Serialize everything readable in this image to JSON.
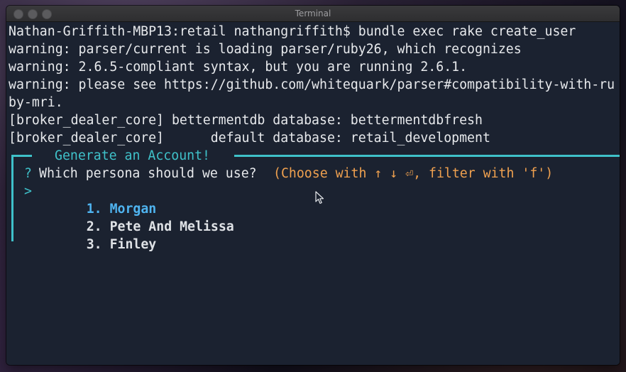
{
  "window": {
    "title": "Terminal"
  },
  "terminal": {
    "lines": [
      "Nathan-Griffith-MBP13:retail nathangriffith$ bundle exec rake create_user",
      "warning: parser/current is loading parser/ruby26, which recognizes",
      "warning: 2.6.5-compliant syntax, but you are running 2.6.1.",
      "warning: please see https://github.com/whitequark/parser#compatibility-with-ru",
      "by-mri.",
      "[broker_dealer_core] bettermentdb database: bettermentdbfresh",
      "[broker_dealer_core]      default database: retail_development"
    ]
  },
  "prompt": {
    "box_title": "Generate an Account!",
    "question_mark": "?",
    "question": "Which persona should we use?",
    "hint": "(Choose with ↑ ↓ ⏎, filter with 'f')",
    "pointer": ">",
    "options": [
      {
        "number": "1.",
        "label": "Morgan",
        "selected": true
      },
      {
        "number": "2.",
        "label": "Pete And Melissa",
        "selected": false
      },
      {
        "number": "3.",
        "label": "Finley",
        "selected": false
      }
    ]
  },
  "colors": {
    "terminal_background": "#1b2230",
    "accent_cyan": "#3fc1c9",
    "hint_orange": "#f0a14f",
    "selected_blue": "#4fb4f0"
  }
}
